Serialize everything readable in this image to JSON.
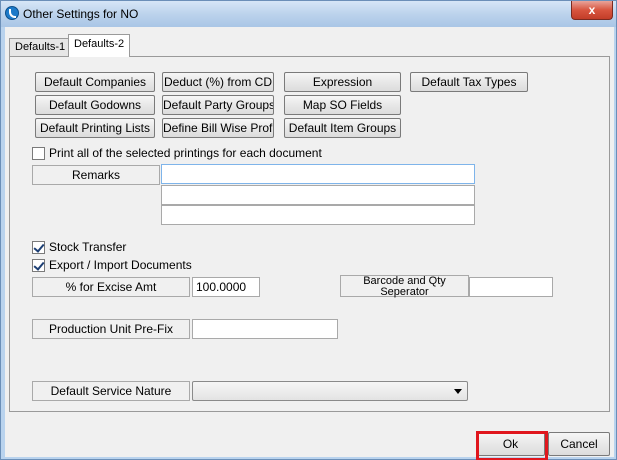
{
  "window": {
    "title": "Other Settings for NO",
    "close_glyph": "x"
  },
  "tabs": [
    "Defaults-1",
    "Defaults-2"
  ],
  "buttons": {
    "default_companies": "Default Companies",
    "deduct_from_cd": "Deduct (%) from CD",
    "expression": "Expression",
    "default_tax_types": "Default Tax Types",
    "default_godowns": "Default Godowns",
    "default_party_groups": "Default Party Groups",
    "map_so_fields": "Map SO Fields",
    "default_printing_lists": "Default Printing Lists",
    "define_bill_wise_profi": "Define Bill Wise Profi",
    "default_item_groups": "Default Item Groups"
  },
  "checkboxes": {
    "print_all": {
      "label": "Print all of the selected printings for each document",
      "checked": false
    },
    "stock_transfer": {
      "label": "Stock Transfer",
      "checked": true
    },
    "export_import": {
      "label": "Export / Import Documents",
      "checked": true
    }
  },
  "fields": {
    "remarks_label": "Remarks",
    "remarks_1": "",
    "remarks_2": "",
    "remarks_3": "",
    "excise_label": "% for Excise Amt",
    "excise_value": "100.0000",
    "barcode_label": "Barcode and Qty Seperator",
    "barcode_value": "",
    "production_label": "Production Unit Pre-Fix",
    "production_value": "",
    "service_label": "Default Service Nature",
    "service_value": ""
  },
  "footer": {
    "ok": "Ok",
    "cancel": "Cancel"
  },
  "colors": {
    "highlight": "#e0161d",
    "title_bar": "#bcd3ec",
    "close_button": "#c23d28"
  }
}
